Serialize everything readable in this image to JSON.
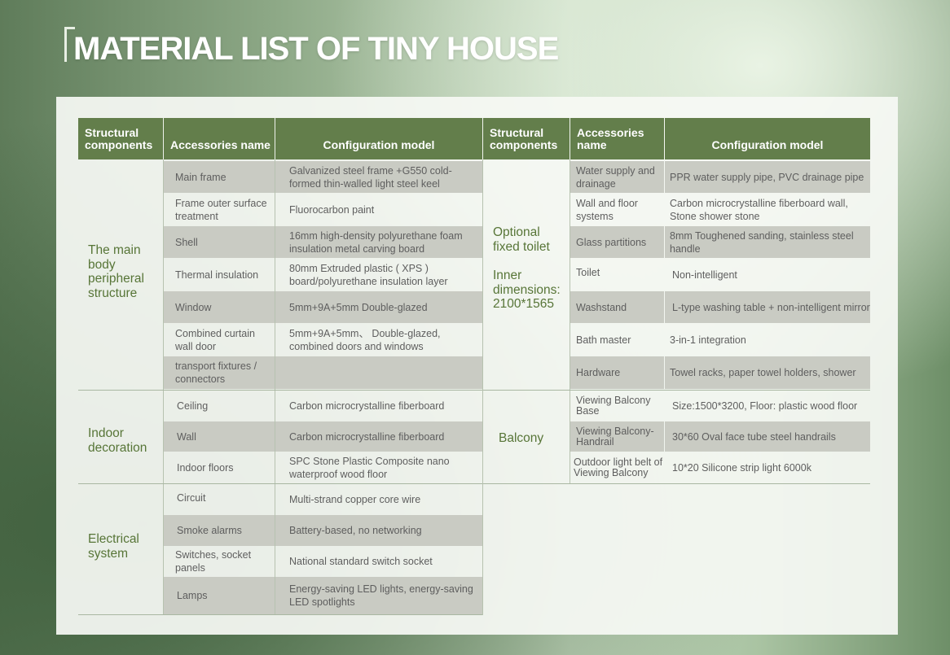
{
  "title": "MATERIAL LIST OF TINY HOUSE",
  "headers": {
    "left": [
      "Structural components",
      "Accessories name",
      "Configuration model"
    ],
    "right": [
      "Structural components",
      "Accessories name",
      "Configuration model"
    ]
  },
  "left_groups": [
    {
      "name": [
        "The main",
        "body",
        "peripheral",
        "structure"
      ]
    },
    {
      "name": [
        "Indoor",
        "decoration"
      ]
    },
    {
      "name": [
        "Electrical",
        "system"
      ]
    }
  ],
  "left_rows": [
    {
      "name": "Main frame",
      "config": "Galvanized steel frame +G550 cold-formed thin-walled light steel keel"
    },
    {
      "name": "Frame outer surface treatment",
      "config": "Fluorocarbon paint"
    },
    {
      "name": "Shell",
      "config": "16mm high-density polyurethane foam insulation metal carving board"
    },
    {
      "name": "Thermal insulation",
      "config": "80mm  Extruded plastic ( XPS ) board/polyurethane insulation layer"
    },
    {
      "name": "Window",
      "config": "5mm+9A+5mm  Double-glazed"
    },
    {
      "name": "Combined curtain wall door",
      "config": "5mm+9A+5mm、 Double-glazed, combined doors and windows"
    },
    {
      "name": "transport fixtures / connectors",
      "config": ""
    },
    {
      "name": "Ceiling",
      "config": "Carbon microcrystalline fiberboard"
    },
    {
      "name": "Wall",
      "config": "Carbon microcrystalline fiberboard"
    },
    {
      "name": "Indoor floors",
      "config": "SPC Stone Plastic Composite nano waterproof wood floor"
    },
    {
      "name": "Circuit",
      "config": "Multi-strand copper core wire"
    },
    {
      "name": "Smoke alarms",
      "config": "Battery-based, no networking"
    },
    {
      "name": "Switches, socket panels",
      "config": "National standard switch socket"
    },
    {
      "name": "Lamps",
      "config": "Energy-saving LED lights, energy-saving LED spotlights"
    }
  ],
  "right_groups": [
    {
      "name": [
        "Optional",
        "fixed toilet"
      ],
      "extra": [
        "Inner",
        "dimensions:",
        "2100*1565"
      ]
    },
    {
      "name": [
        "Balcony"
      ]
    }
  ],
  "right_rows": [
    {
      "name": "Water supply and drainage",
      "config": "PPR water supply pipe, PVC drainage pipe"
    },
    {
      "name": "Wall and floor systems",
      "config": "Carbon microcrystalline fiberboard wall, Stone shower stone"
    },
    {
      "name": "Glass partitions",
      "config": "8mm Toughened sanding, stainless steel handle"
    },
    {
      "name": "Toilet",
      "config": "Non-intelligent"
    },
    {
      "name": "Washstand",
      "config": "L-type washing table + non-intelligent mirror"
    },
    {
      "name": "Bath master",
      "config": "3-in-1 integration"
    },
    {
      "name": "Hardware",
      "config": "Towel racks, paper towel holders, shower"
    },
    {
      "name": "Viewing Balcony Base",
      "config": "Size:1500*3200,  Floor: plastic wood floor"
    },
    {
      "name": "Viewing Balcony-Handrail",
      "config": "30*60 Oval face tube steel handrails"
    },
    {
      "name": "Outdoor light belt of  Viewing Balcony",
      "config": "10*20  Silicone strip light  6000k"
    }
  ]
}
